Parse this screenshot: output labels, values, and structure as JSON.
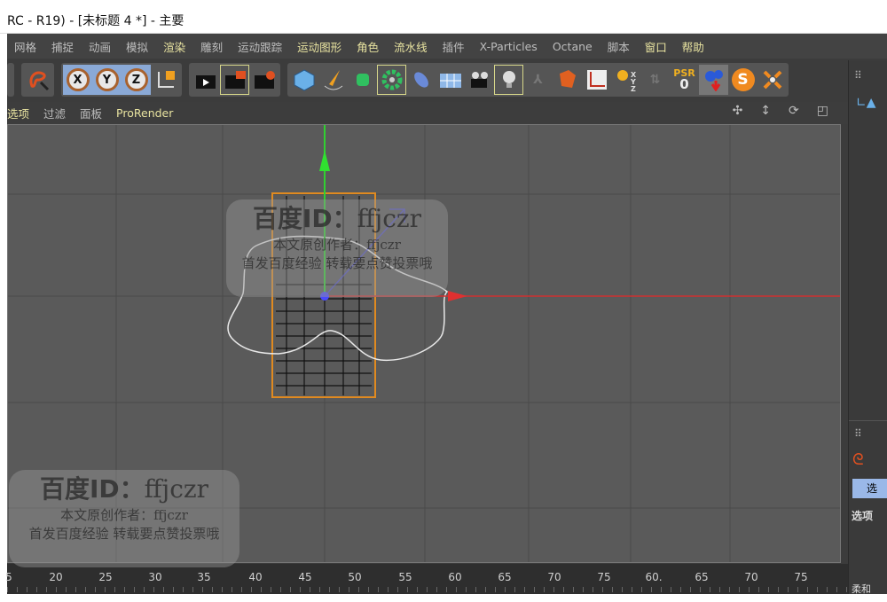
{
  "window": {
    "title": "RC - R19) - [未标题 4 *] - 主要"
  },
  "menu": [
    {
      "label": "网格"
    },
    {
      "label": "捕捉"
    },
    {
      "label": "动画"
    },
    {
      "label": "模拟"
    },
    {
      "label": "渲染",
      "hl": true
    },
    {
      "label": "雕刻"
    },
    {
      "label": "运动跟踪"
    },
    {
      "label": "运动图形",
      "hl": true
    },
    {
      "label": "角色",
      "hl": true
    },
    {
      "label": "流水线",
      "hl": true
    },
    {
      "label": "插件"
    },
    {
      "label": "X-Particles"
    },
    {
      "label": "Octane"
    },
    {
      "label": "脚本"
    },
    {
      "label": "窗口",
      "hl": true
    },
    {
      "label": "帮助",
      "hl": true
    }
  ],
  "toolbar": {
    "x": "X",
    "y": "Y",
    "z": "Z",
    "psr": "PSR",
    "psr_value": "0",
    "s": "S"
  },
  "viewport_menu": {
    "options": "选项",
    "filter": "过滤",
    "panel": "面板",
    "prorender": "ProRender"
  },
  "right_panel": {
    "tab": "选",
    "options": "选项",
    "bottom": "柔和"
  },
  "timeline": {
    "ticks": [
      "5",
      "20",
      "25",
      "30",
      "35",
      "40",
      "45",
      "50",
      "55",
      "60",
      "65",
      "70",
      "75",
      "60.",
      "65",
      "70",
      "75"
    ]
  },
  "watermark": {
    "id_label": "百度ID：",
    "id": "ffjczr",
    "author": "本文原创作者：ffjczr",
    "note": "首发百度经验 转载要点赞投票哦"
  },
  "colors": {
    "x_axis": "#e03030",
    "y_axis": "#30d030",
    "z_axis": "#4a4aff",
    "selection": "#e08a20",
    "spline": "#e8e8e8"
  }
}
